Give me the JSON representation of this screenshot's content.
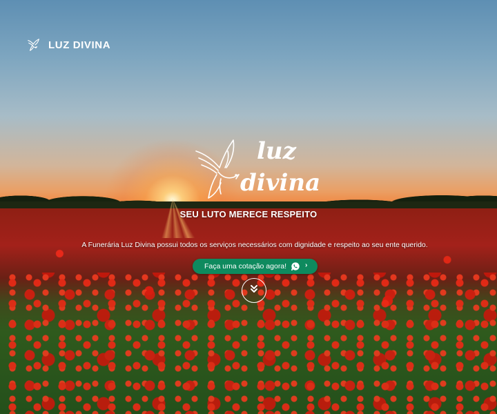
{
  "header": {
    "brand_name": "LUZ DIVINA",
    "brand_icon": "dove-icon"
  },
  "hero": {
    "logo_word1": "luz",
    "logo_word2": "divina",
    "logo_icon": "dove-icon",
    "tagline": "SEU LUTO MERECE RESPEITO",
    "description": "A Funerária Luz Divina possui todos os serviços necessários com dignidade e respeito ao seu ente querido.",
    "cta": {
      "label": "Faça uma cotação agora!",
      "icon": "whatsapp-icon",
      "trailing_icon": "chevron-right-icon",
      "color": "#0e8a5e"
    },
    "scroll_button_icon": "double-chevron-down-icon"
  },
  "colors": {
    "text": "#ffffff",
    "cta_green": "#0e8a5e"
  }
}
